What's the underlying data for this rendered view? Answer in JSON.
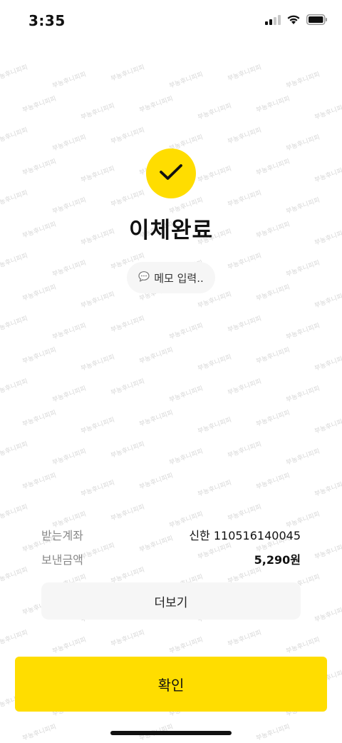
{
  "status_bar": {
    "time": "3:35"
  },
  "watermark": "부농후니피피",
  "result": {
    "title": "이체완료",
    "memo_placeholder": "메모 입력.."
  },
  "details": {
    "receive_account_label": "받는계좌",
    "receive_account_value": "신한 110516140045",
    "sent_amount_label": "보낸금액",
    "sent_amount_value": "5,290원"
  },
  "buttons": {
    "more_label": "더보기",
    "confirm_label": "확인"
  },
  "colors": {
    "accent": "#FFDD00",
    "chip_bg": "#f6f6f6",
    "label_gray": "#888888"
  },
  "icons": {
    "check": "check-icon",
    "memo": "speech-bubble-icon",
    "signal": "signal-icon",
    "wifi": "wifi-icon",
    "battery": "battery-icon"
  }
}
